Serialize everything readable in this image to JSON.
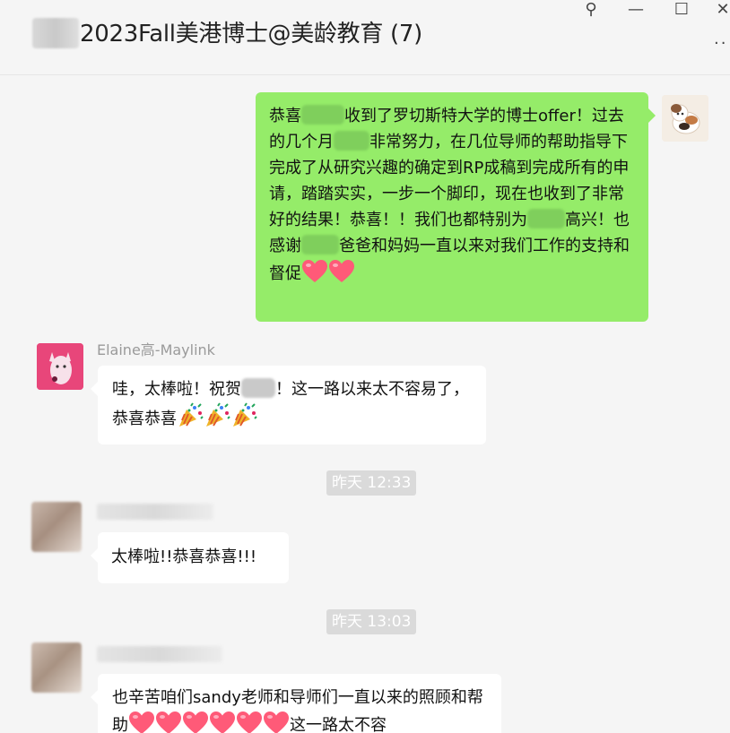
{
  "window": {
    "title": "2023Fall美港博士@美龄教育 (7)",
    "controls": {
      "pin": "⚲",
      "minimize": "—",
      "maximize": "☐",
      "close": "✕",
      "more": "··"
    }
  },
  "messages": [
    {
      "id": "m1",
      "side": "right",
      "segments": [
        {
          "t": "恭喜"
        },
        {
          "redact": 48
        },
        {
          "t": "收到了罗切斯特大学的博士offer！过去的几个月"
        },
        {
          "redact": 40
        },
        {
          "t": "非常努力，在几位导师的帮助指导下完成了从研究兴趣的确定到RP成稿到完成所有的申请，踏踏实实，一步一个脚印，现在也收到了非常好的结果！恭喜！！我们也都特别为"
        },
        {
          "redact": 42
        },
        {
          "t": "高兴！也感谢"
        },
        {
          "redact": 42
        },
        {
          "t": "爸爸和妈妈一直以来对我们工作的支持和督促"
        },
        {
          "heart": 1
        },
        {
          "heart": 1
        }
      ]
    },
    {
      "id": "m2",
      "side": "left",
      "sender": "Elaine高-Maylink",
      "segments": [
        {
          "t": "哇，太棒啦！祝贺"
        },
        {
          "redact": 38
        },
        {
          "t": "！这一路以来太不容易了，恭喜恭喜"
        },
        {
          "party": 1
        },
        {
          "party": 1
        },
        {
          "party": 1
        }
      ]
    },
    {
      "id": "t1",
      "time": "昨天 12:33"
    },
    {
      "id": "m3",
      "side": "left",
      "sender": "",
      "segments": [
        {
          "t": "太棒啦!!恭喜恭喜!!!"
        }
      ]
    },
    {
      "id": "t2",
      "time": "昨天 13:03"
    },
    {
      "id": "m4",
      "side": "left",
      "sender": "",
      "segments": [
        {
          "t": "也辛苦咱们sandy老师和导师们一直以来的照顾和帮助"
        },
        {
          "heart": 1
        },
        {
          "heart": 1
        },
        {
          "heart": 1
        },
        {
          "heart": 1
        },
        {
          "heart": 1
        },
        {
          "heart": 1
        },
        {
          "t": "这一路太不容"
        }
      ]
    }
  ],
  "colors": {
    "accent_bubble_self": "#95ec69",
    "bubble_other": "#ffffff",
    "background": "#f5f5f5",
    "timestamp_bg": "#dadada",
    "heart": "#ff5a78"
  },
  "icons": {
    "heart": "red-heart-icon",
    "party": "party-popper-icon"
  }
}
